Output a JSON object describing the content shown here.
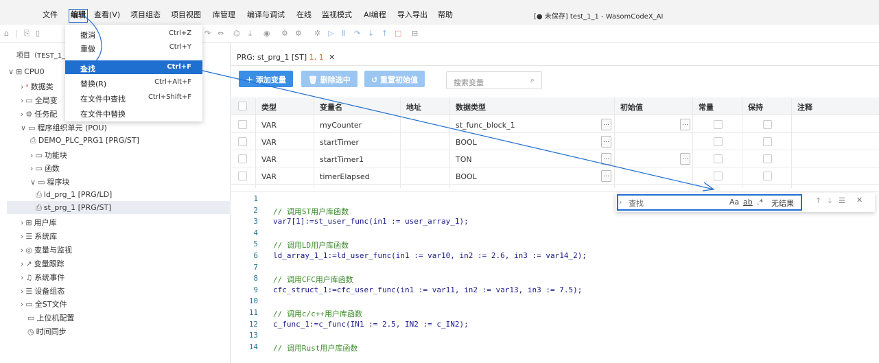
{
  "window": {
    "title": "[● 未保存] test_1_1 - WasomCodeX_AI"
  },
  "menubar": [
    "文件",
    "编辑",
    "查看(V)",
    "项目组态",
    "项目视图",
    "库管理",
    "编译与调试",
    "在线",
    "监视模式",
    "AI编程",
    "导入导出",
    "帮助"
  ],
  "edit_menu": [
    {
      "label": "撤消",
      "shortcut": "Ctrl+Z"
    },
    {
      "label": "重做",
      "shortcut": "Ctrl+Y"
    },
    {
      "label": "查找",
      "shortcut": "Ctrl+F"
    },
    {
      "label": "替换(R)",
      "shortcut": "Ctrl+Alt+F"
    },
    {
      "label": "在文件中查找",
      "shortcut": "Ctrl+Shift+F"
    },
    {
      "label": "在文件中替换",
      "shortcut": ""
    }
  ],
  "sidebar": {
    "header": "项目（TEST_1_1",
    "items": [
      {
        "label": "CPU0",
        "icon": "cpu-icon"
      },
      {
        "label": "数据类",
        "icon": "datatype-icon"
      },
      {
        "label": "全局变",
        "icon": "folder-icon"
      },
      {
        "label": "任务配",
        "icon": "gear-icon"
      },
      {
        "label": "程序组织单元 (POU)",
        "icon": "folder-icon"
      },
      {
        "label": "DEMO_PLC_PRG1 [PRG/ST]",
        "icon": "program-icon"
      },
      {
        "label": "功能块",
        "icon": "folder-icon"
      },
      {
        "label": "函数",
        "icon": "folder-icon"
      },
      {
        "label": "程序块",
        "icon": "folder-icon"
      },
      {
        "label": "ld_prg_1 [PRG/LD]",
        "icon": "program-icon"
      },
      {
        "label": "st_prg_1 [PRG/ST]",
        "icon": "program-icon"
      },
      {
        "label": "用户库",
        "icon": "library-icon"
      },
      {
        "label": "系统库",
        "icon": "library-icon"
      },
      {
        "label": "变量与监视",
        "icon": "eye-icon"
      },
      {
        "label": "变量跟踪",
        "icon": "trend-icon"
      },
      {
        "label": "系统事件",
        "icon": "bell-icon"
      },
      {
        "label": "设备组态",
        "icon": "device-icon"
      },
      {
        "label": "全ST文件",
        "icon": "folder-icon"
      },
      {
        "label": "上位机配置",
        "icon": "monitor-icon"
      },
      {
        "label": "时间同步",
        "icon": "clock-icon"
      }
    ]
  },
  "tab": {
    "label": "PRG: st_prg_1 [ST]",
    "pos": "1, 1"
  },
  "buttons": {
    "add": "添加变量",
    "delete": "删除选中",
    "reset": "重置初始值"
  },
  "search": {
    "placeholder": "搜索变量"
  },
  "table": {
    "headers": [
      "类型",
      "变量名",
      "地址",
      "数据类型",
      "初始值",
      "常量",
      "保持",
      "注释"
    ],
    "rows": [
      [
        "VAR",
        "myCounter",
        "",
        "st_func_block_1"
      ],
      [
        "VAR",
        "startTimer",
        "",
        "BOOL"
      ],
      [
        "VAR",
        "startTimer1",
        "",
        "TON"
      ],
      [
        "VAR",
        "timerElapsed",
        "",
        "BOOL"
      ]
    ]
  },
  "code": [
    {
      "n": "1",
      "t": "",
      "c": false
    },
    {
      "n": "2",
      "t": "// 调用ST用户库函数",
      "c": true
    },
    {
      "n": "3",
      "t": "var7[1]:=st_user_func(in1 := user_array_1);",
      "c": false
    },
    {
      "n": "4",
      "t": "",
      "c": false
    },
    {
      "n": "5",
      "t": "// 调用LD用户库函数",
      "c": true
    },
    {
      "n": "6",
      "t": "ld_array_1_1:=ld_user_func(in1 := var10, in2 := 2.6, in3 := var14_2);",
      "c": false
    },
    {
      "n": "7",
      "t": "",
      "c": false
    },
    {
      "n": "8",
      "t": "// 调用CFC用户库函数",
      "c": true
    },
    {
      "n": "9",
      "t": "cfc_struct_1:=cfc_user_func(in1 := var11, in2 := var13, in3 := 7.5);",
      "c": false
    },
    {
      "n": "10",
      "t": "",
      "c": false
    },
    {
      "n": "11",
      "t": "// 调用c/c++用户库函数",
      "c": true
    },
    {
      "n": "12",
      "t": "c_func_1:=c_func(IN1 := 2.5, IN2 := c_IN2);",
      "c": false
    },
    {
      "n": "13",
      "t": "",
      "c": false
    },
    {
      "n": "14",
      "t": "// 调用Rust用户库函数",
      "c": true
    }
  ],
  "find": {
    "placeholder": "查找",
    "match_case": "Aa",
    "whole_word": "ab",
    "regex": ".*",
    "result": "无结果"
  },
  "colors": {
    "accent": "#1f6fd0",
    "primary_button": "#3a8ee6",
    "disabled_button": "#9cc6f2"
  }
}
